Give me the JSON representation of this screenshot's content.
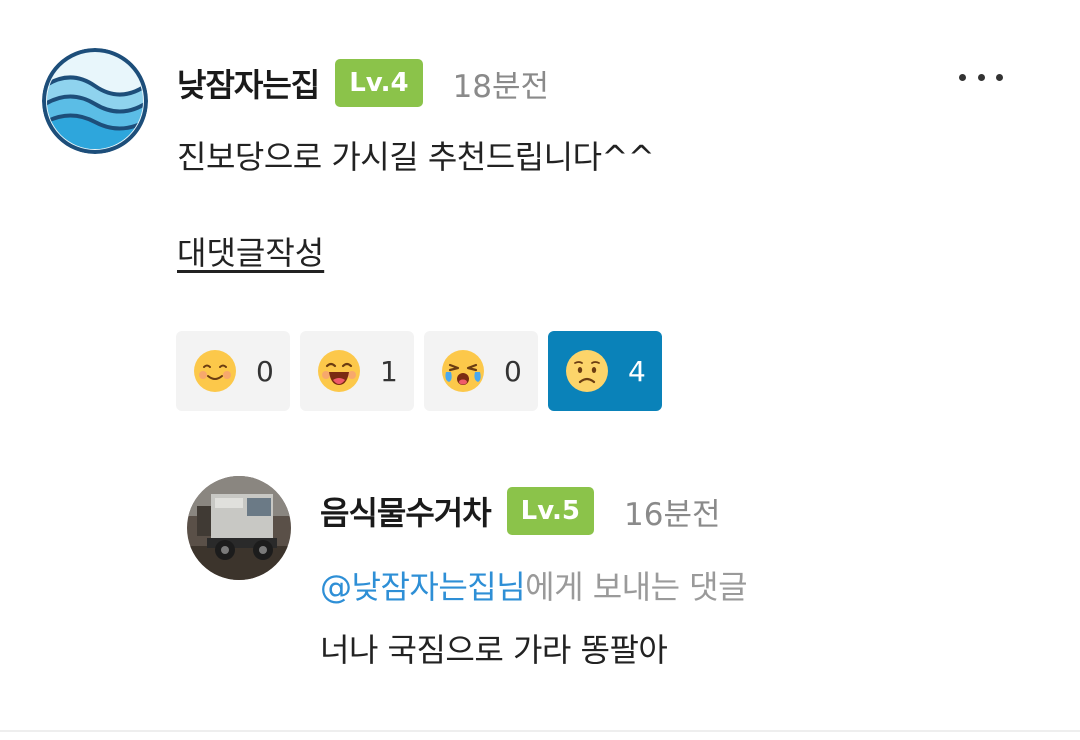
{
  "comment": {
    "author": "낮잠자는집",
    "level": "Lv.4",
    "level_color": "#8bc34a",
    "time": "18분전",
    "text": "진보당으로 가시길 추천드립니다^^",
    "reply_link": "대댓글작성",
    "more_icon": "more-horizontal-icon",
    "reactions": [
      {
        "icon": "smile-emoji-icon",
        "count": "0",
        "active": false
      },
      {
        "icon": "laugh-emoji-icon",
        "count": "1",
        "active": false
      },
      {
        "icon": "crying-emoji-icon",
        "count": "0",
        "active": false
      },
      {
        "icon": "sad-emoji-icon",
        "count": "4",
        "active": true
      }
    ],
    "active_color": "#0a82b9"
  },
  "reply": {
    "author": "음식물수거차",
    "level": "Lv.5",
    "level_color": "#8bc34a",
    "time": "16분전",
    "mention": "@낮잠자는집님",
    "mention_suffix": "에게 보내는 댓글",
    "text": "너나 국짐으로 가라 똥팔아"
  }
}
